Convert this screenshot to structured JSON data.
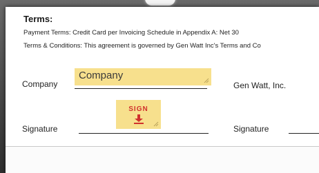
{
  "terms": {
    "title": "Terms:",
    "payment": "Payment Terms: Credit Card per Invoicing Schedule in Appendix A: Net 30",
    "conditions": "Terms & Conditions: This agreement is governed by Gen Watt Inc's Terms and Co"
  },
  "fields": {
    "company_label": "Company",
    "company_value": "Company",
    "counterparty_company": "Gen Watt, Inc.",
    "signature_label": "Signature",
    "signature_label_right": "Signature",
    "sign_button": "SIGN"
  },
  "colors": {
    "field_highlight": "#f7e08d",
    "sign_red": "#d0312d"
  },
  "icons": {
    "sign_arrow": "arrow-down-to-line-icon",
    "resize_corner": "resize-corner-icon"
  }
}
